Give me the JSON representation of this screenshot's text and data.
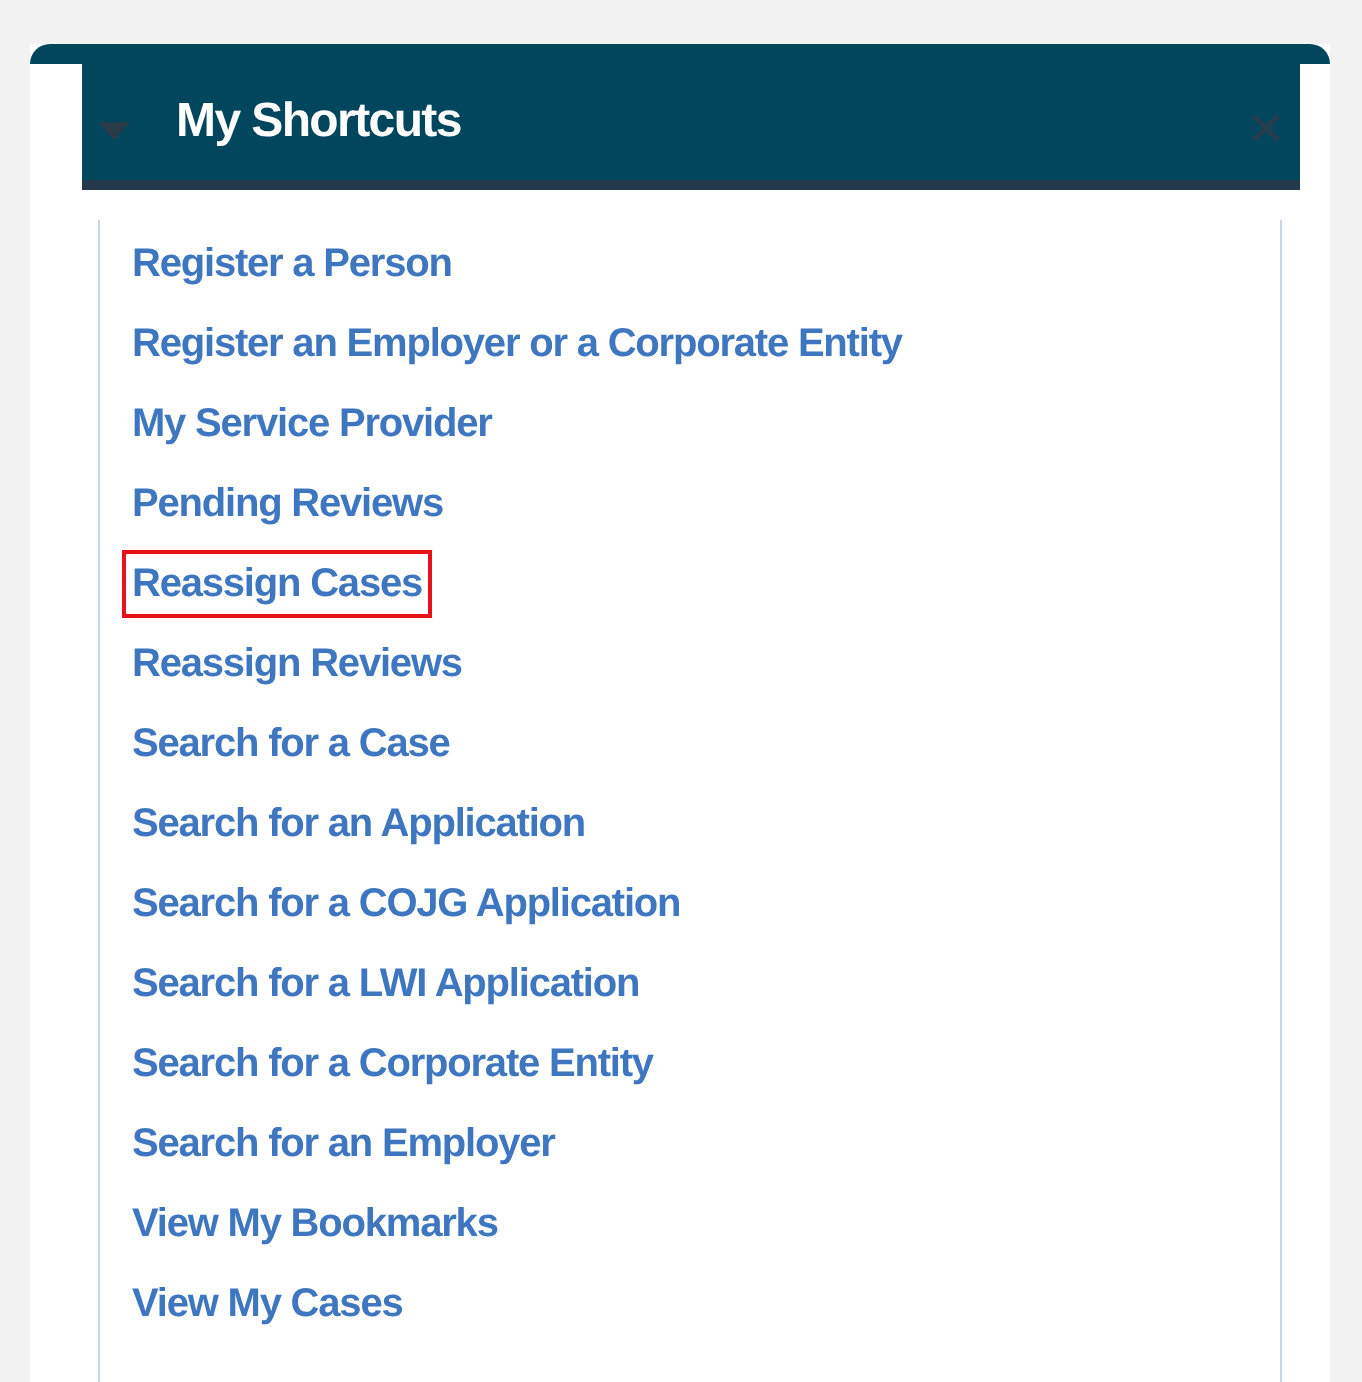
{
  "panel": {
    "title": "My Shortcuts"
  },
  "shortcuts": [
    {
      "label": "Register a Person",
      "highlighted": false
    },
    {
      "label": "Register an Employer or a Corporate Entity",
      "highlighted": false
    },
    {
      "label": "My Service Provider",
      "highlighted": false
    },
    {
      "label": "Pending Reviews",
      "highlighted": false
    },
    {
      "label": "Reassign Cases",
      "highlighted": true
    },
    {
      "label": "Reassign Reviews",
      "highlighted": false
    },
    {
      "label": "Search for a Case",
      "highlighted": false
    },
    {
      "label": "Search for an Application",
      "highlighted": false
    },
    {
      "label": "Search for a COJG Application",
      "highlighted": false
    },
    {
      "label": "Search for a LWI Application",
      "highlighted": false
    },
    {
      "label": "Search for a Corporate Entity",
      "highlighted": false
    },
    {
      "label": "Search for an Employer",
      "highlighted": false
    },
    {
      "label": "View My Bookmarks",
      "highlighted": false
    },
    {
      "label": "View My Cases",
      "highlighted": false
    }
  ]
}
